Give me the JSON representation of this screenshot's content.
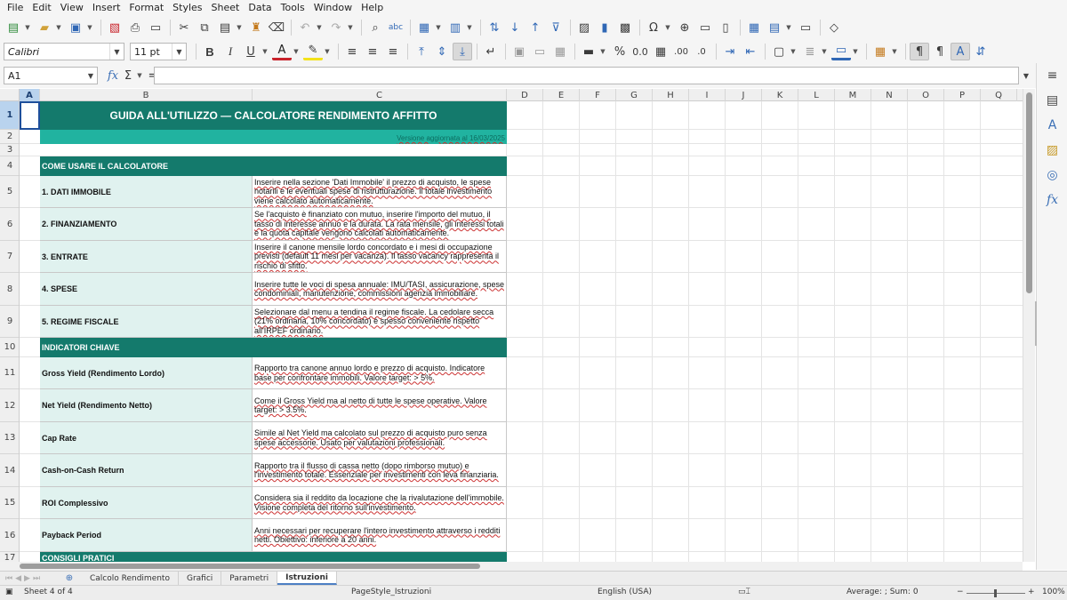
{
  "menu": [
    "File",
    "Edit",
    "View",
    "Insert",
    "Format",
    "Styles",
    "Sheet",
    "Data",
    "Tools",
    "Window",
    "Help"
  ],
  "font": {
    "name": "Calibri",
    "size": "11 pt"
  },
  "formula_bar": {
    "name_box": "A1",
    "fx_icon": "function-wizard-icon",
    "sum_icon": "sum-icon",
    "equals": "=",
    "content": ""
  },
  "columns": [
    "A",
    "B",
    "C",
    "D",
    "E",
    "F",
    "G",
    "H",
    "I",
    "J",
    "K",
    "L",
    "M",
    "N",
    "O",
    "P",
    "Q"
  ],
  "rows": [
    "1",
    "2",
    "3",
    "4",
    "5",
    "6",
    "7",
    "8",
    "9",
    "10",
    "11",
    "12",
    "13",
    "14",
    "15",
    "16",
    "17"
  ],
  "sheet": {
    "title": "GUIDA ALL'UTILIZZO — CALCOLATORE RENDIMENTO AFFITTO",
    "version": "Versione aggiornata al 16/03/2025",
    "section_how_to": "COME USARE IL CALCOLATORE",
    "steps": [
      {
        "label": "1. DATI IMMOBILE",
        "desc": "Inserire nella sezione 'Dati Immobile' il prezzo di acquisto, le spese notarili e le eventuali spese di ristrutturazione. Il totale investimento viene calcolato automaticamente."
      },
      {
        "label": "2. FINANZIAMENTO",
        "desc": "Se l'acquisto è finanziato con mutuo, inserire l'importo del mutuo, il tasso di interesse annuo e la durata. La rata mensile, gli interessi totali e la quota capitale vengono calcolati automaticamente."
      },
      {
        "label": "3. ENTRATE",
        "desc": "Inserire il canone mensile lordo concordato e i mesi di occupazione previsti (default 11 mesi per vacanza). Il tasso vacancy rappresenta il rischio di sfitto."
      },
      {
        "label": "4. SPESE",
        "desc": "Inserire tutte le voci di spesa annuale: IMU/TASI, assicurazione, spese condominiali, manutenzione, commissioni agenzia immobiliare."
      },
      {
        "label": "5. REGIME FISCALE",
        "desc": "Selezionare dal menu a tendina il regime fiscale. La cedolare secca (21% ordinaria, 10% concordato) è spesso conveniente rispetto all'IRPEF ordinario."
      }
    ],
    "section_indicators": "INDICATORI CHIAVE",
    "indicators": [
      {
        "label": "Gross Yield (Rendimento Lordo)",
        "desc": "Rapporto tra canone annuo lordo e prezzo di acquisto. Indicatore base per confrontare immobili. Valore target: > 5%."
      },
      {
        "label": "Net Yield (Rendimento Netto)",
        "desc": "Come il Gross Yield ma al netto di tutte le spese operative. Valore target: > 3.5%."
      },
      {
        "label": "Cap Rate",
        "desc": "Simile al Net Yield ma calcolato sul prezzo di acquisto puro senza spese accessorie. Usato per valutazioni professionali."
      },
      {
        "label": "Cash-on-Cash Return",
        "desc": "Rapporto tra il flusso di cassa netto (dopo rimborso mutuo) e l'investimento totale. Essenziale per investimenti con leva finanziaria."
      },
      {
        "label": "ROI Complessivo",
        "desc": "Considera sia il reddito da locazione che la rivalutazione dell'immobile. Visione completa del ritorno sull'investimento."
      },
      {
        "label": "Payback Period",
        "desc": "Anni necessari per recuperare l'intero investimento attraverso i redditi netti. Obiettivo: inferiore a 20 anni."
      }
    ],
    "section_tips": "CONSIGLI PRATICI"
  },
  "tabs": [
    "Calcolo Rendimento",
    "Grafici",
    "Parametri",
    "Istruzioni"
  ],
  "active_tab": "Istruzioni",
  "status": {
    "sheet": "Sheet 4 of 4",
    "page_style": "PageStyle_Istruzioni",
    "language": "English (USA)",
    "summary": "Average: ; Sum: 0",
    "zoom": "100%"
  },
  "colors": {
    "teal_dark": "#147a6c",
    "teal_light": "#21b3a0",
    "label_bg": "#e0f2ef"
  }
}
